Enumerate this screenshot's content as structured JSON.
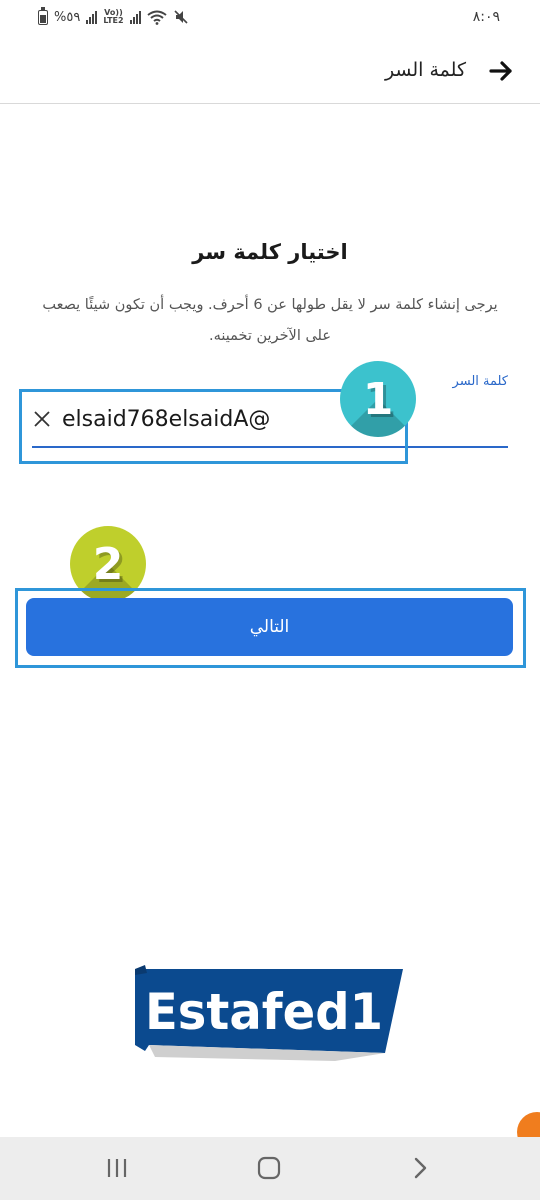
{
  "status_bar": {
    "battery_text": "%٥٩",
    "volte_top": "Vo))",
    "volte_bottom": "LTE2",
    "time": "٨:٠٩"
  },
  "header": {
    "title": "كلمة السر",
    "back_icon": "arrow-right-icon"
  },
  "main": {
    "title": "اختيار كلمة سر",
    "description": "يرجى إنشاء كلمة سر لا يقل طولها عن 6 أحرف. ويجب أن تكون شيئًا يصعب على الآخرين تخمينه.",
    "password_field": {
      "label": "كلمة السر",
      "value": "elsaid768elsaidA@",
      "clear_icon": "close-icon"
    },
    "next_button_label": "التالي"
  },
  "annotations": {
    "badge_1": "1",
    "badge_2": "2",
    "watermark_text": "Estafed1"
  },
  "colors": {
    "accent": "#2872de",
    "highlight_frame": "#2f96d9",
    "badge_1": "#3cc2cd",
    "badge_2": "#bfcf2c",
    "watermark_bg": "#0b4a8f"
  },
  "nav_bar": {
    "recent_icon": "recent-apps-icon",
    "home_icon": "home-icon",
    "back_icon": "chevron-right-icon"
  }
}
